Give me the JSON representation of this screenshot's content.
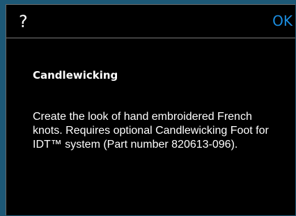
{
  "dialog": {
    "help_glyph": "?",
    "ok_label": "OK",
    "title": "Candlewicking",
    "description": "Create the look of hand embroidered French knots. Requires optional Candlewicking Foot for IDT™ system (Part number 820613-096)."
  },
  "colors": {
    "accent": "#1b8de0",
    "background": "#000000",
    "text": "#ffffff",
    "frame": "#1d5876"
  },
  "icons": {
    "help": "question-mark-icon"
  }
}
